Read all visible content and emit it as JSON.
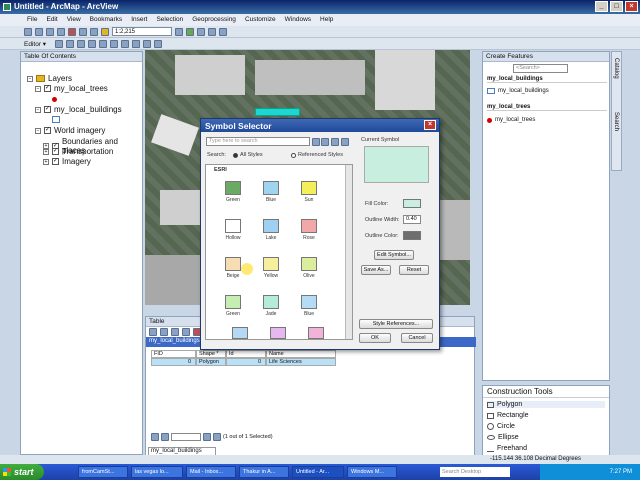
{
  "window": {
    "title": "Untitled - ArcMap - ArcView"
  },
  "menu": [
    "File",
    "Edit",
    "View",
    "Bookmarks",
    "Insert",
    "Selection",
    "Geoprocessing",
    "Customize",
    "Windows",
    "Help"
  ],
  "toolbar": {
    "scale": "1:2,215",
    "editor_label": "Editor ▾"
  },
  "toc": {
    "title": "Table Of Contents",
    "layers_label": "Layers",
    "items": [
      {
        "label": "my_local_trees"
      },
      {
        "label": "my_local_buildings"
      },
      {
        "label": "World imagery"
      },
      {
        "label": "Boundaries and places"
      },
      {
        "label": "Transportation"
      },
      {
        "label": "Imagery"
      }
    ]
  },
  "dialog": {
    "title": "Symbol Selector",
    "search_placeholder": "Type here to search",
    "search_label": "Search:",
    "all_styles": "All Styles",
    "referenced_styles": "Referenced Styles",
    "group_label": "ESRI",
    "current_symbol_label": "Current Symbol",
    "fill_color_label": "Fill Color:",
    "outline_width_label": "Outline Width:",
    "outline_width_value": "0.40",
    "outline_color_label": "Outline Color:",
    "edit_symbol": "Edit Symbol...",
    "save_as": "Save As...",
    "reset": "Reset",
    "style_references": "Style References...",
    "ok": "OK",
    "cancel": "Cancel",
    "swatches": [
      {
        "name": "Green",
        "color": "#6aaa64"
      },
      {
        "name": "Blue",
        "color": "#9fd4f0"
      },
      {
        "name": "Sun",
        "color": "#f3ef5a"
      },
      {
        "name": "Hollow",
        "color": "#ffffff"
      },
      {
        "name": "Lake",
        "color": "#9fd0f2"
      },
      {
        "name": "Rose",
        "color": "#f2a8a8"
      },
      {
        "name": "Beige",
        "color": "#f6ddb3"
      },
      {
        "name": "Yellow",
        "color": "#f6ef9e"
      },
      {
        "name": "Olive",
        "color": "#dbee9e"
      },
      {
        "name": "Green",
        "color": "#c6eeb2"
      },
      {
        "name": "Jade",
        "color": "#b5ecd8"
      },
      {
        "name": "Blue",
        "color": "#b5dcf5"
      }
    ],
    "current_symbol_color": "#c8eee0"
  },
  "table": {
    "title": "Table",
    "tab_label": "my_local_buildings",
    "columns": [
      "FID",
      "Shape *",
      "Id",
      "Name"
    ],
    "rows": [
      [
        "0",
        "Polygon",
        "0",
        "Life Sciences"
      ]
    ],
    "footer": "(1 out of 1 Selected)",
    "bottom_tab": "my_local_buildings"
  },
  "create_features": {
    "title": "Create Features",
    "search_placeholder": "<Search>",
    "groups": [
      {
        "header": "my_local_buildings",
        "item": "my_local_buildings"
      },
      {
        "header": "my_local_trees",
        "item": "my_local_trees"
      }
    ]
  },
  "side_tabs": [
    "Catalog",
    "Search"
  ],
  "construction_tools": {
    "title": "Construction Tools",
    "items": [
      "Polygon",
      "Rectangle",
      "Circle",
      "Ellipse",
      "Freehand"
    ]
  },
  "status": {
    "coords": "-115.144  36.108 Decimal Degrees"
  },
  "taskbar": {
    "start": "start",
    "tasks": [
      "fromCamSt...",
      "las vegas lo...",
      "Mail - Inbox...",
      "Thakur in A...",
      "Untitled - Ar...",
      "Windows M..."
    ],
    "search_placeholder": "Search Desktop",
    "clock": "7:27 PM"
  }
}
